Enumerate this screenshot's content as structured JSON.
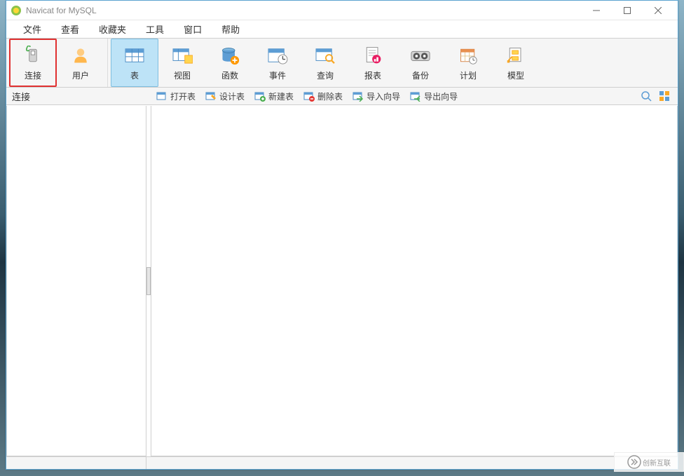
{
  "title": "Navicat for MySQL",
  "menu": {
    "items": [
      "文件",
      "查看",
      "收藏夹",
      "工具",
      "窗口",
      "帮助"
    ]
  },
  "toolbar": {
    "group1": [
      {
        "label": "连接",
        "icon": "connection",
        "highlighted": true
      },
      {
        "label": "用户",
        "icon": "user"
      }
    ],
    "group2": [
      {
        "label": "表",
        "icon": "table",
        "active": true
      },
      {
        "label": "视图",
        "icon": "view"
      },
      {
        "label": "函数",
        "icon": "function"
      },
      {
        "label": "事件",
        "icon": "event"
      },
      {
        "label": "查询",
        "icon": "query"
      },
      {
        "label": "报表",
        "icon": "report"
      },
      {
        "label": "备份",
        "icon": "backup"
      },
      {
        "label": "计划",
        "icon": "schedule"
      },
      {
        "label": "模型",
        "icon": "model"
      }
    ]
  },
  "subbar": {
    "left_label": "连接",
    "items": [
      {
        "label": "打开表",
        "icon": "open-table"
      },
      {
        "label": "设计表",
        "icon": "design-table"
      },
      {
        "label": "新建表",
        "icon": "new-table"
      },
      {
        "label": "删除表",
        "icon": "delete-table"
      },
      {
        "label": "导入向导",
        "icon": "import-wizard"
      },
      {
        "label": "导出向导",
        "icon": "export-wizard"
      }
    ]
  },
  "watermark": "创新互联"
}
